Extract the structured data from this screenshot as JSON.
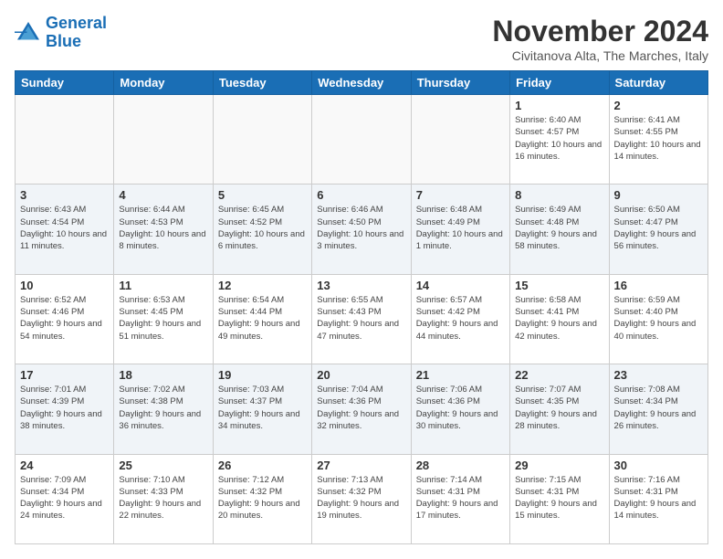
{
  "logo": {
    "line1": "General",
    "line2": "Blue"
  },
  "title": "November 2024",
  "subtitle": "Civitanova Alta, The Marches, Italy",
  "days_of_week": [
    "Sunday",
    "Monday",
    "Tuesday",
    "Wednesday",
    "Thursday",
    "Friday",
    "Saturday"
  ],
  "weeks": [
    [
      {
        "day": "",
        "info": ""
      },
      {
        "day": "",
        "info": ""
      },
      {
        "day": "",
        "info": ""
      },
      {
        "day": "",
        "info": ""
      },
      {
        "day": "",
        "info": ""
      },
      {
        "day": "1",
        "info": "Sunrise: 6:40 AM\nSunset: 4:57 PM\nDaylight: 10 hours and 16 minutes."
      },
      {
        "day": "2",
        "info": "Sunrise: 6:41 AM\nSunset: 4:55 PM\nDaylight: 10 hours and 14 minutes."
      }
    ],
    [
      {
        "day": "3",
        "info": "Sunrise: 6:43 AM\nSunset: 4:54 PM\nDaylight: 10 hours and 11 minutes."
      },
      {
        "day": "4",
        "info": "Sunrise: 6:44 AM\nSunset: 4:53 PM\nDaylight: 10 hours and 8 minutes."
      },
      {
        "day": "5",
        "info": "Sunrise: 6:45 AM\nSunset: 4:52 PM\nDaylight: 10 hours and 6 minutes."
      },
      {
        "day": "6",
        "info": "Sunrise: 6:46 AM\nSunset: 4:50 PM\nDaylight: 10 hours and 3 minutes."
      },
      {
        "day": "7",
        "info": "Sunrise: 6:48 AM\nSunset: 4:49 PM\nDaylight: 10 hours and 1 minute."
      },
      {
        "day": "8",
        "info": "Sunrise: 6:49 AM\nSunset: 4:48 PM\nDaylight: 9 hours and 58 minutes."
      },
      {
        "day": "9",
        "info": "Sunrise: 6:50 AM\nSunset: 4:47 PM\nDaylight: 9 hours and 56 minutes."
      }
    ],
    [
      {
        "day": "10",
        "info": "Sunrise: 6:52 AM\nSunset: 4:46 PM\nDaylight: 9 hours and 54 minutes."
      },
      {
        "day": "11",
        "info": "Sunrise: 6:53 AM\nSunset: 4:45 PM\nDaylight: 9 hours and 51 minutes."
      },
      {
        "day": "12",
        "info": "Sunrise: 6:54 AM\nSunset: 4:44 PM\nDaylight: 9 hours and 49 minutes."
      },
      {
        "day": "13",
        "info": "Sunrise: 6:55 AM\nSunset: 4:43 PM\nDaylight: 9 hours and 47 minutes."
      },
      {
        "day": "14",
        "info": "Sunrise: 6:57 AM\nSunset: 4:42 PM\nDaylight: 9 hours and 44 minutes."
      },
      {
        "day": "15",
        "info": "Sunrise: 6:58 AM\nSunset: 4:41 PM\nDaylight: 9 hours and 42 minutes."
      },
      {
        "day": "16",
        "info": "Sunrise: 6:59 AM\nSunset: 4:40 PM\nDaylight: 9 hours and 40 minutes."
      }
    ],
    [
      {
        "day": "17",
        "info": "Sunrise: 7:01 AM\nSunset: 4:39 PM\nDaylight: 9 hours and 38 minutes."
      },
      {
        "day": "18",
        "info": "Sunrise: 7:02 AM\nSunset: 4:38 PM\nDaylight: 9 hours and 36 minutes."
      },
      {
        "day": "19",
        "info": "Sunrise: 7:03 AM\nSunset: 4:37 PM\nDaylight: 9 hours and 34 minutes."
      },
      {
        "day": "20",
        "info": "Sunrise: 7:04 AM\nSunset: 4:36 PM\nDaylight: 9 hours and 32 minutes."
      },
      {
        "day": "21",
        "info": "Sunrise: 7:06 AM\nSunset: 4:36 PM\nDaylight: 9 hours and 30 minutes."
      },
      {
        "day": "22",
        "info": "Sunrise: 7:07 AM\nSunset: 4:35 PM\nDaylight: 9 hours and 28 minutes."
      },
      {
        "day": "23",
        "info": "Sunrise: 7:08 AM\nSunset: 4:34 PM\nDaylight: 9 hours and 26 minutes."
      }
    ],
    [
      {
        "day": "24",
        "info": "Sunrise: 7:09 AM\nSunset: 4:34 PM\nDaylight: 9 hours and 24 minutes."
      },
      {
        "day": "25",
        "info": "Sunrise: 7:10 AM\nSunset: 4:33 PM\nDaylight: 9 hours and 22 minutes."
      },
      {
        "day": "26",
        "info": "Sunrise: 7:12 AM\nSunset: 4:32 PM\nDaylight: 9 hours and 20 minutes."
      },
      {
        "day": "27",
        "info": "Sunrise: 7:13 AM\nSunset: 4:32 PM\nDaylight: 9 hours and 19 minutes."
      },
      {
        "day": "28",
        "info": "Sunrise: 7:14 AM\nSunset: 4:31 PM\nDaylight: 9 hours and 17 minutes."
      },
      {
        "day": "29",
        "info": "Sunrise: 7:15 AM\nSunset: 4:31 PM\nDaylight: 9 hours and 15 minutes."
      },
      {
        "day": "30",
        "info": "Sunrise: 7:16 AM\nSunset: 4:31 PM\nDaylight: 9 hours and 14 minutes."
      }
    ]
  ]
}
